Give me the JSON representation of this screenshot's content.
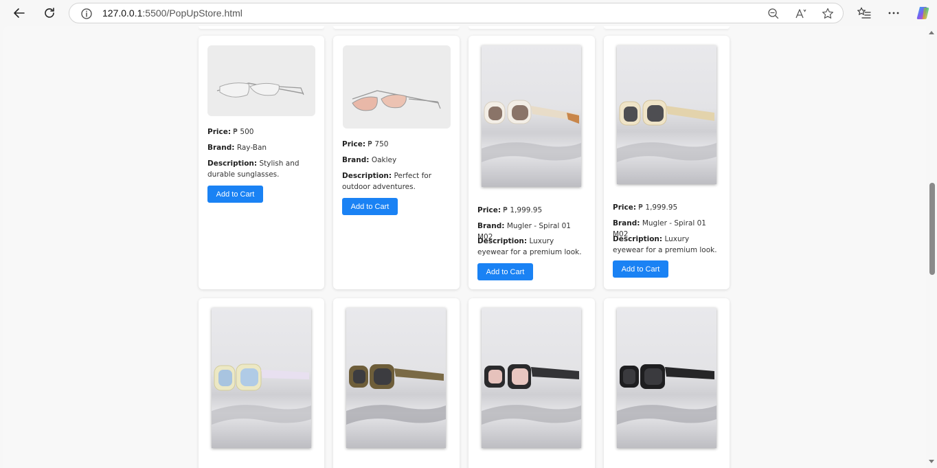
{
  "browser": {
    "url_host": "127.0.0.1",
    "url_path": ":5500/PopUpStore.html"
  },
  "labels": {
    "price": "Price:",
    "brand": "Brand:",
    "description": "Description:",
    "add_to_cart": "Add to Cart"
  },
  "products": [
    {
      "price": "₱ 500",
      "brand": "Ray-Ban",
      "description": "Stylish and durable sunglasses.",
      "image": "rimless-silver-glasses"
    },
    {
      "price": "₱ 750",
      "brand": "Oakley",
      "description": "Perfect for outdoor adventures.",
      "image": "silver-frame-tinted-glasses"
    },
    {
      "price": "₱ 1,999.95",
      "brand": "Mugler - Spiral 01 M02",
      "description": "Luxury eyewear for a premium look.",
      "image": "white-frame-sunglasses-water"
    },
    {
      "price": "₱ 1,999.95",
      "brand": "Mugler - Spiral 01 M02",
      "description": "Luxury eyewear for a premium look.",
      "image": "cream-frame-sunglasses-water"
    },
    {
      "image": "cream-frame-blue-lens-sunglasses"
    },
    {
      "image": "olive-frame-sunglasses"
    },
    {
      "image": "black-frame-pink-lens-sunglasses"
    },
    {
      "image": "black-frame-dark-lens-sunglasses"
    }
  ],
  "colors": {
    "button": "#1a82f4",
    "page_bg": "#f8f8f8",
    "card_bg": "#ffffff"
  }
}
